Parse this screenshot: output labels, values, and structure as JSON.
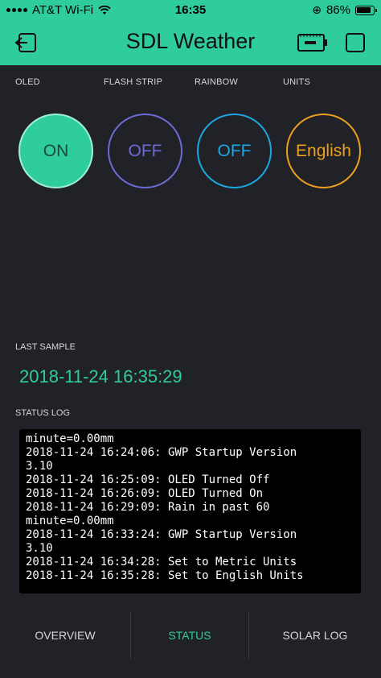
{
  "statusbar": {
    "carrier": "AT&T Wi-Fi",
    "time": "16:35",
    "battery": "86%"
  },
  "header": {
    "title": "SDL Weather"
  },
  "controls": [
    {
      "label": "OLED",
      "value": "ON",
      "color": "#2fcc9c"
    },
    {
      "label": "FLASH STRIP",
      "value": "OFF",
      "color": "#6b6bd9"
    },
    {
      "label": "RAINBOW",
      "value": "OFF",
      "color": "#1da7e2"
    },
    {
      "label": "UNITS",
      "value": "English",
      "color": "#eda01d"
    }
  ],
  "last_sample": {
    "label": "LAST SAMPLE",
    "value": "2018-11-24 16:35:29"
  },
  "status_log": {
    "label": "STATUS LOG",
    "lines": [
      "minute=0.00mm",
      "2018-11-24 16:24:06: GWP Startup Version",
      "3.10",
      "2018-11-24 16:25:09: OLED Turned Off",
      "2018-11-24 16:26:09: OLED Turned On",
      "2018-11-24 16:29:09: Rain in past 60",
      "minute=0.00mm",
      "2018-11-24 16:33:24: GWP Startup Version",
      "3.10",
      "2018-11-24 16:34:28: Set to Metric Units",
      "2018-11-24 16:35:28: Set to English Units"
    ]
  },
  "tabs": [
    {
      "label": "OVERVIEW"
    },
    {
      "label": "STATUS"
    },
    {
      "label": "SOLAR LOG"
    }
  ],
  "accent_color": "#2fcc9c",
  "background_color": "#212227"
}
